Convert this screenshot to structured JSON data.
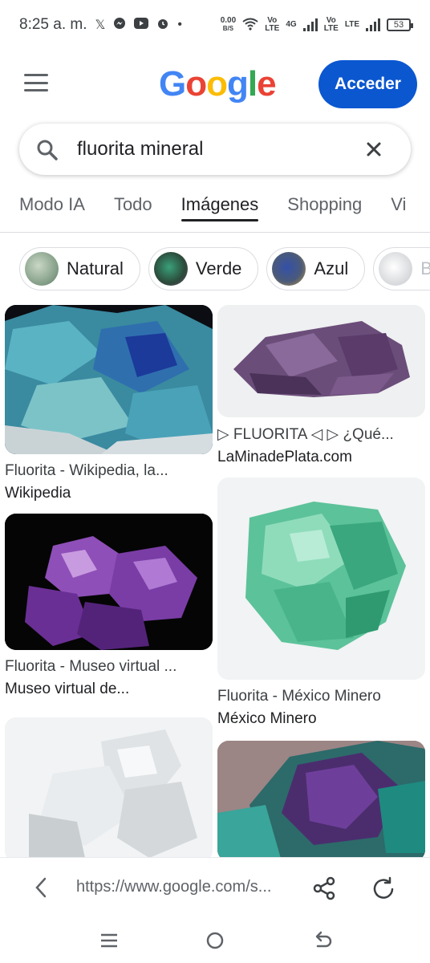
{
  "status_bar": {
    "time": "8:25 a. m.",
    "speed_value": "0.00",
    "speed_unit": "B/S",
    "volte1": "Vo",
    "volte1_sub": "LTE",
    "net": "4G",
    "volte2": "Vo",
    "volte2_sub": "LTE",
    "lte": "LTE",
    "battery": "53"
  },
  "header": {
    "logo_letters": [
      "G",
      "o",
      "o",
      "g",
      "l",
      "e"
    ],
    "logo_colors": [
      "#4285F4",
      "#EA4335",
      "#FBBC05",
      "#4285F4",
      "#34A853",
      "#EA4335"
    ],
    "sign_in_label": "Acceder"
  },
  "search": {
    "query": "fluorita mineral"
  },
  "tabs": [
    {
      "label": "Modo IA",
      "active": false
    },
    {
      "label": "Todo",
      "active": false
    },
    {
      "label": "Imágenes",
      "active": true
    },
    {
      "label": "Shopping",
      "active": false
    },
    {
      "label": "Vi",
      "active": false
    }
  ],
  "chips": [
    {
      "label": "Natural"
    },
    {
      "label": "Verde"
    },
    {
      "label": "Azul"
    },
    {
      "label": "B"
    }
  ],
  "results_left": [
    {
      "title": "Fluorita - Wikipedia, la...",
      "source": "Wikipedia"
    },
    {
      "title": "Fluorita - Museo virtual ...",
      "source": "Museo virtual de..."
    },
    {
      "title": "",
      "source": ""
    }
  ],
  "results_right": [
    {
      "title": "▷ FLUORITA ◁ ▷ ¿Qué...",
      "source": "LaMinadePlata.com"
    },
    {
      "title": "Fluorita - México Minero",
      "source": "México Minero"
    },
    {
      "title": "",
      "source": ""
    }
  ],
  "bottom_bar": {
    "url": "https://www.google.com/s..."
  },
  "colors": {
    "accent": "#0b57d0",
    "text": "#202124",
    "muted": "#5f6368"
  }
}
